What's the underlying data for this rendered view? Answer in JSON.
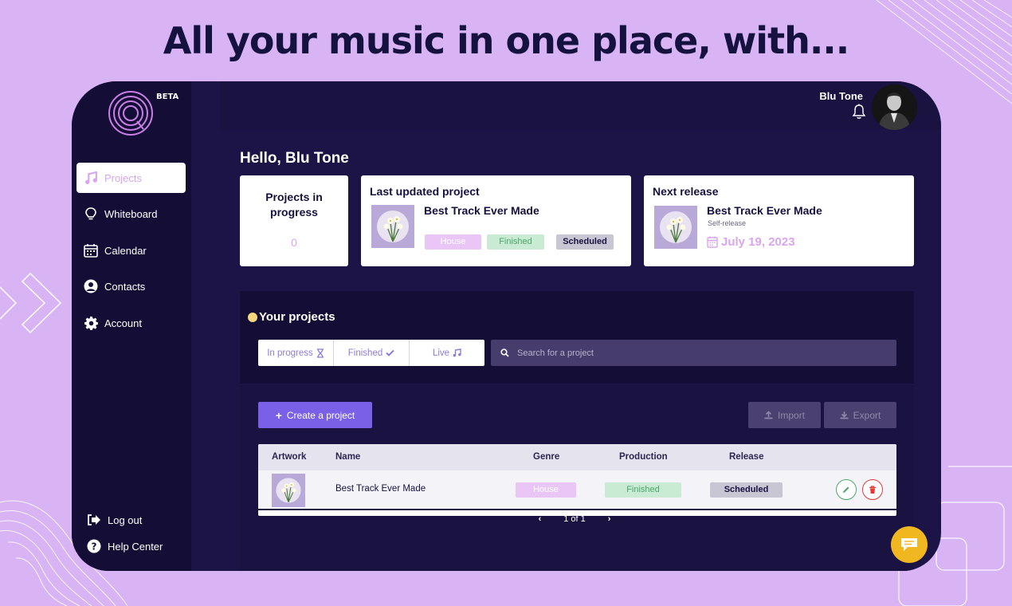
{
  "headline": "All your music in one place, with...",
  "brand": {
    "beta": "BETA",
    "accent": "#7a60e6",
    "highlight": "#d9a5ef"
  },
  "sidebar": {
    "items": [
      {
        "label": "Projects",
        "icon": "music-note-icon",
        "active": true
      },
      {
        "label": "Whiteboard",
        "icon": "lightbulb-icon"
      },
      {
        "label": "Calendar",
        "icon": "calendar-icon"
      },
      {
        "label": "Contacts",
        "icon": "user-circle-icon"
      },
      {
        "label": "Account",
        "icon": "gear-icon"
      }
    ],
    "bottom": [
      {
        "label": "Log out",
        "icon": "logout-icon"
      },
      {
        "label": "Help Center",
        "icon": "help-icon"
      }
    ]
  },
  "header": {
    "user_name": "Blu Tone",
    "bell": "bell-icon"
  },
  "greeting": "Hello, Blu Tone",
  "cards": {
    "in_progress": {
      "title": "Projects in progress",
      "value": "0"
    },
    "last_updated": {
      "title": "Last updated project",
      "track": "Best Track Ever Made",
      "badges": [
        "House",
        "Finished",
        "Scheduled"
      ]
    },
    "next_release": {
      "title": "Next release",
      "track": "Best Track Ever Made",
      "subtitle": "Self-release",
      "date": "July 19, 2023"
    }
  },
  "projects": {
    "title": "Your projects",
    "filters": [
      {
        "label": "In progress",
        "icon": "hourglass-icon"
      },
      {
        "label": "Finished",
        "icon": "check-icon"
      },
      {
        "label": "Live",
        "icon": "music-icon"
      }
    ],
    "search_placeholder": "Search for a project"
  },
  "table": {
    "create_label": "Create a project",
    "import_label": "Import",
    "export_label": "Export",
    "columns": [
      "Artwork",
      "Name",
      "Genre",
      "Production",
      "Release"
    ],
    "rows": [
      {
        "name": "Best Track Ever Made",
        "genre": "House",
        "production": "Finished",
        "release": "Scheduled"
      }
    ],
    "pagination": "1 of 1"
  }
}
